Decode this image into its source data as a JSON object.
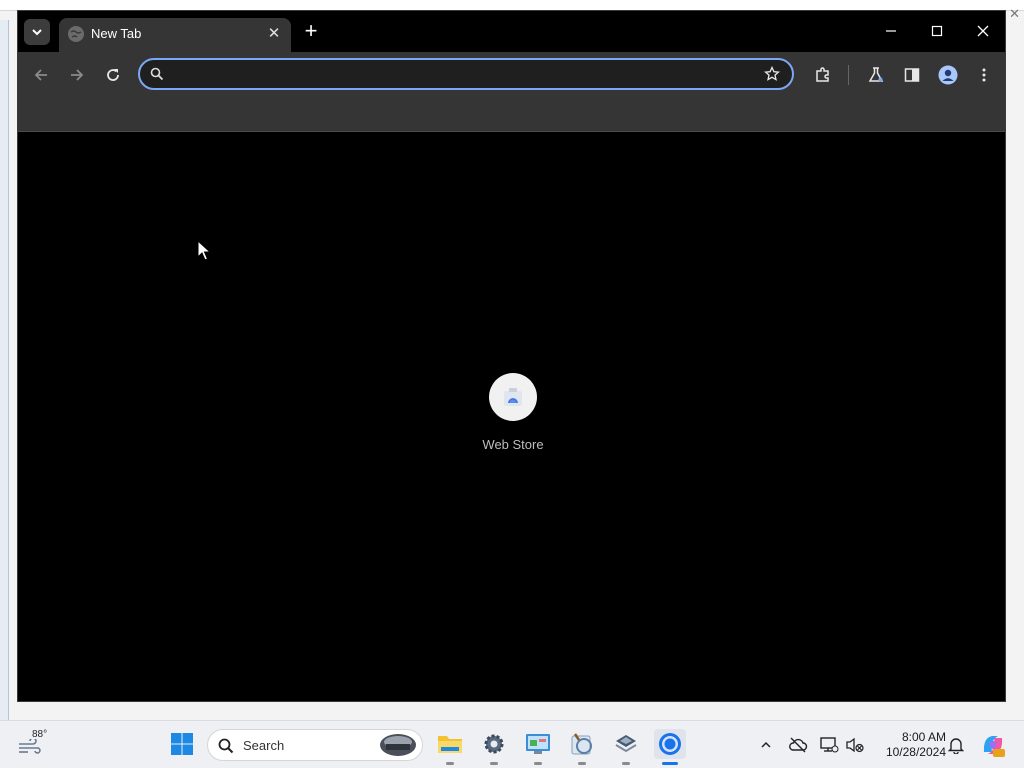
{
  "browser": {
    "tab": {
      "title": "New Tab"
    },
    "omnibox": {
      "value": "",
      "placeholder": ""
    },
    "shortcuts": [
      {
        "label": "Web Store",
        "icon": "web-store-icon"
      }
    ]
  },
  "taskbar": {
    "weather_temp": "88°",
    "search_label": "Search",
    "clock": {
      "time": "8:00 AM",
      "date": "10/28/2024"
    }
  },
  "colors": {
    "accent": "#7ca7f4",
    "chrome_toolbar": "#353535",
    "content_bg": "#000000"
  }
}
